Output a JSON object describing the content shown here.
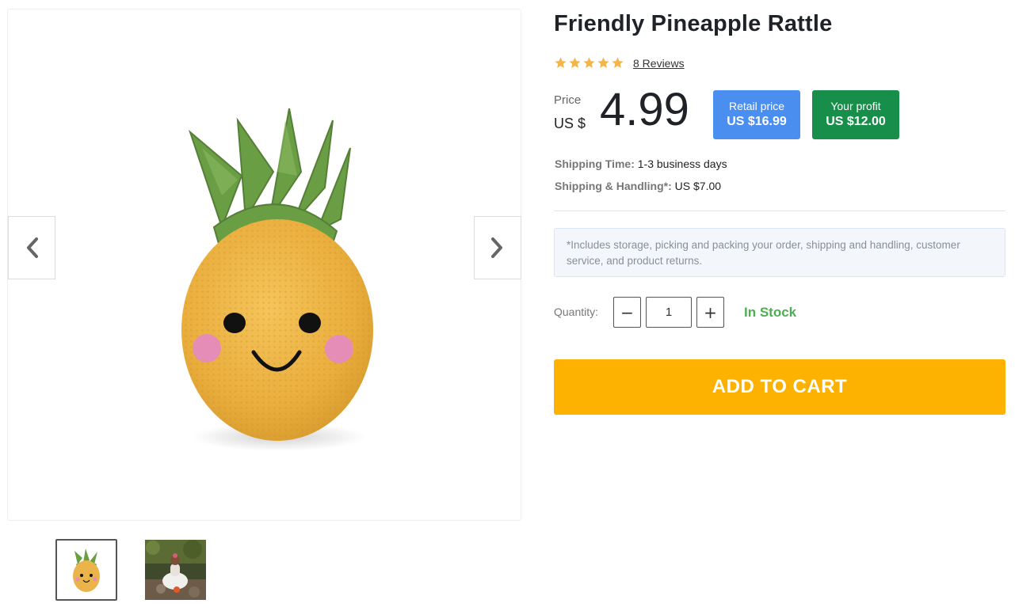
{
  "product": {
    "title": "Friendly Pineapple Rattle",
    "rating_stars": 5,
    "reviews_label": "8 Reviews"
  },
  "pricing": {
    "price_label": "Price",
    "currency": "US $",
    "price": "4.99",
    "retail_label": "Retail price",
    "retail_value": "US $16.99",
    "profit_label": "Your profit",
    "profit_value": "US $12.00"
  },
  "shipping": {
    "time_label": "Shipping Time:",
    "time_value": "1-3 business days",
    "handling_label": "Shipping & Handling*:",
    "handling_value": "US $7.00"
  },
  "note": "*Includes storage, picking and packing your order, shipping and handling, customer service, and product returns.",
  "quantity": {
    "label": "Quantity:",
    "value": "1",
    "minus_symbol": "−",
    "plus_symbol": "+"
  },
  "stock_status": "In Stock",
  "cart_button": "ADD TO CART",
  "colors": {
    "star": "#f5b54a",
    "retail_bg": "#4a8ef0",
    "profit_bg": "#178f4a",
    "in_stock": "#4caf50",
    "cart_bg": "#fdb100"
  },
  "icons": {
    "prev": "chevron-left-icon",
    "next": "chevron-right-icon",
    "rating": "star-icon"
  }
}
